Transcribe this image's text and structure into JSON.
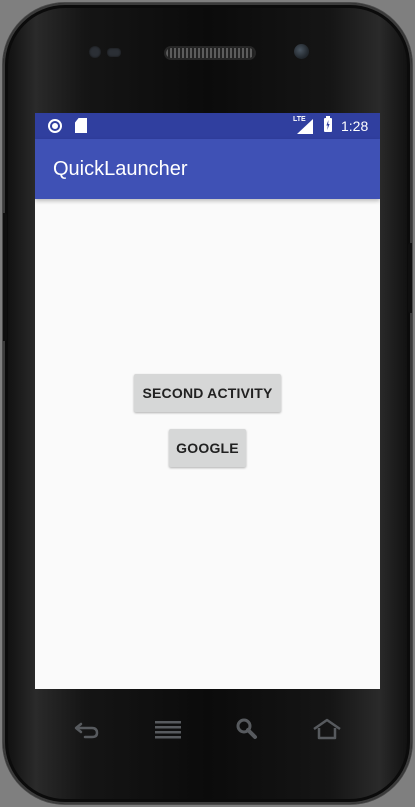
{
  "status_bar": {
    "icons": [
      "circle-notification-icon",
      "sd-card-icon",
      "lte-icon",
      "cell-signal-icon",
      "battery-charging-icon"
    ],
    "network_label": "LTE",
    "time": "1:28",
    "background_color": "#303f9f"
  },
  "app_bar": {
    "title": "QuickLauncher",
    "background_color": "#3f51b5"
  },
  "main": {
    "buttons": [
      {
        "label": "SECOND ACTIVITY"
      },
      {
        "label": "GOOGLE"
      }
    ]
  },
  "hardware_keys": {
    "icons": [
      "back-icon",
      "menu-icon",
      "search-icon",
      "home-icon"
    ]
  }
}
